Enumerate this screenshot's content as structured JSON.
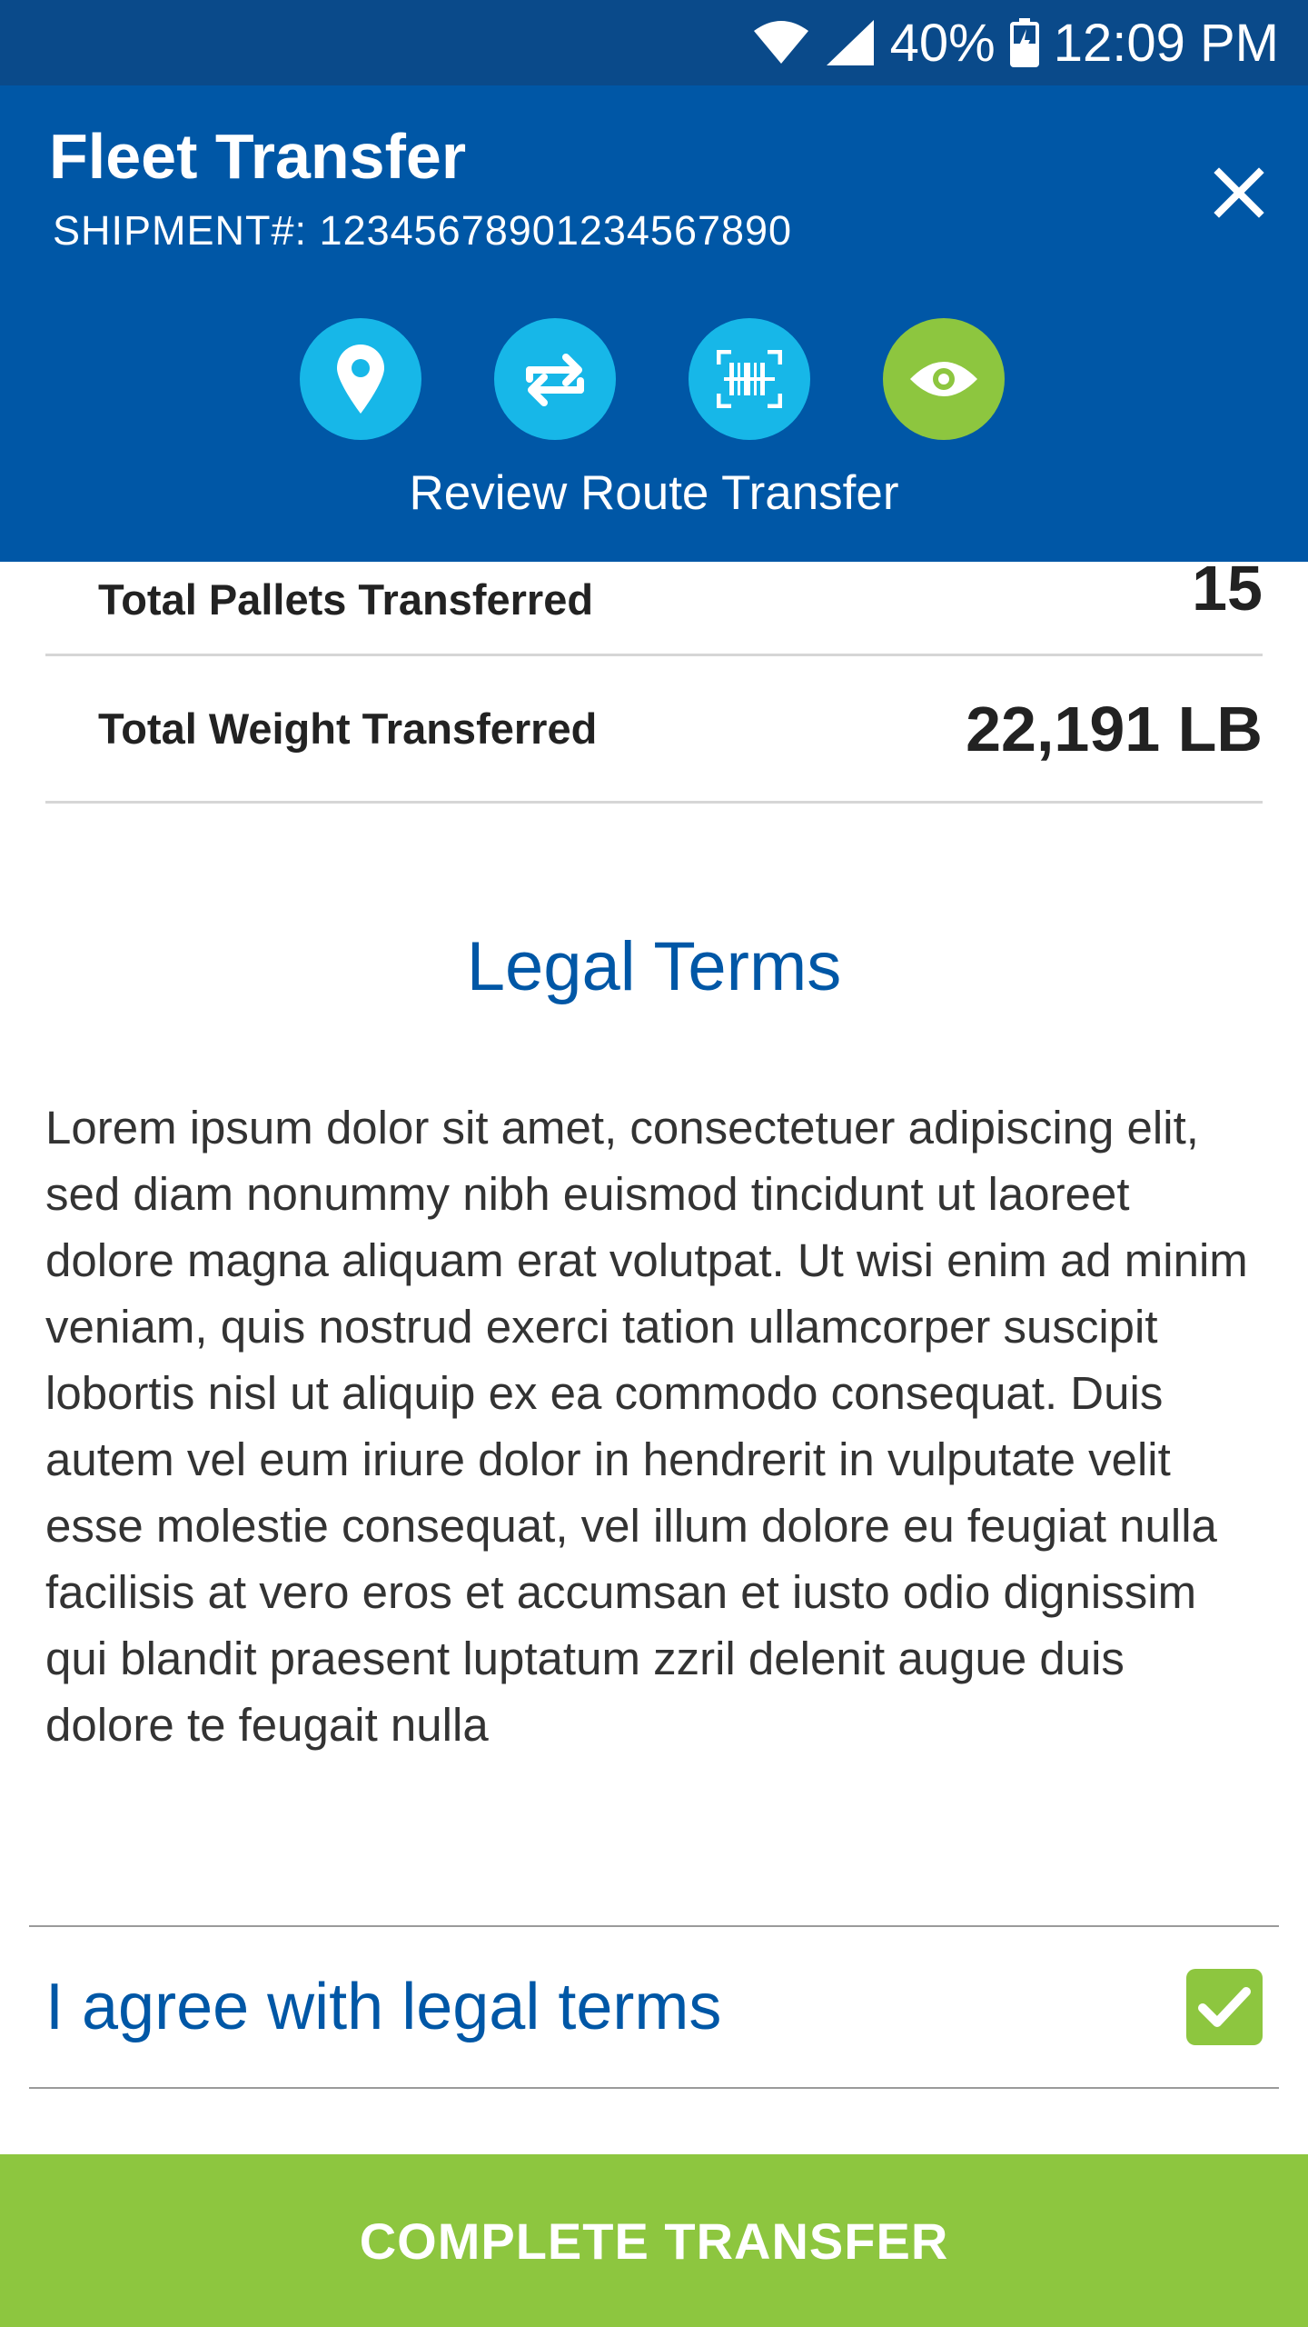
{
  "status_bar": {
    "battery": "40%",
    "time": "12:09 PM",
    "icons": [
      "wifi-icon",
      "signal-icon",
      "battery-icon"
    ]
  },
  "header": {
    "title": "Fleet Transfer",
    "shipment": "SHIPMENT#: 12345678901234567890",
    "close_icon": "close-icon",
    "steps": [
      {
        "icon": "location-pin-icon",
        "active": false
      },
      {
        "icon": "swap-arrows-icon",
        "active": false
      },
      {
        "icon": "barcode-scan-icon",
        "active": false
      },
      {
        "icon": "eye-icon",
        "active": true
      }
    ],
    "step_label": "Review Route Transfer"
  },
  "summary": {
    "pallets_label": "Total Pallets Transferred",
    "pallets_value": "15",
    "weight_label": "Total Weight Transferred",
    "weight_value": "22,191 LB"
  },
  "legal": {
    "title": "Legal Terms",
    "text": "Lorem ipsum dolor sit amet, consectetuer adipiscing elit, sed diam nonummy nibh euismod tincidunt ut laoreet dolore magna aliquam erat volutpat. Ut wisi enim ad minim veniam, quis nostrud exerci tation ullamcorper suscipit lobortis nisl ut aliquip ex ea commodo consequat. Duis autem vel eum iriure dolor in hendrerit in vulputate velit esse molestie consequat, vel illum dolore eu feugiat nulla facilisis at vero eros et accumsan et iusto odio dignissim qui blandit praesent luptatum zzril delenit augue duis dolore te feugait nulla",
    "agree_label": "I agree with legal terms",
    "agree_checked": true
  },
  "actions": {
    "complete_label": "COMPLETE TRANSFER"
  },
  "colors": {
    "status_bar": "#0a4a8a",
    "header": "#0057a6",
    "step_inactive": "#17b7e8",
    "step_active": "#8dc63f",
    "accent_green": "#8dc63f",
    "link_blue": "#0057a6"
  }
}
